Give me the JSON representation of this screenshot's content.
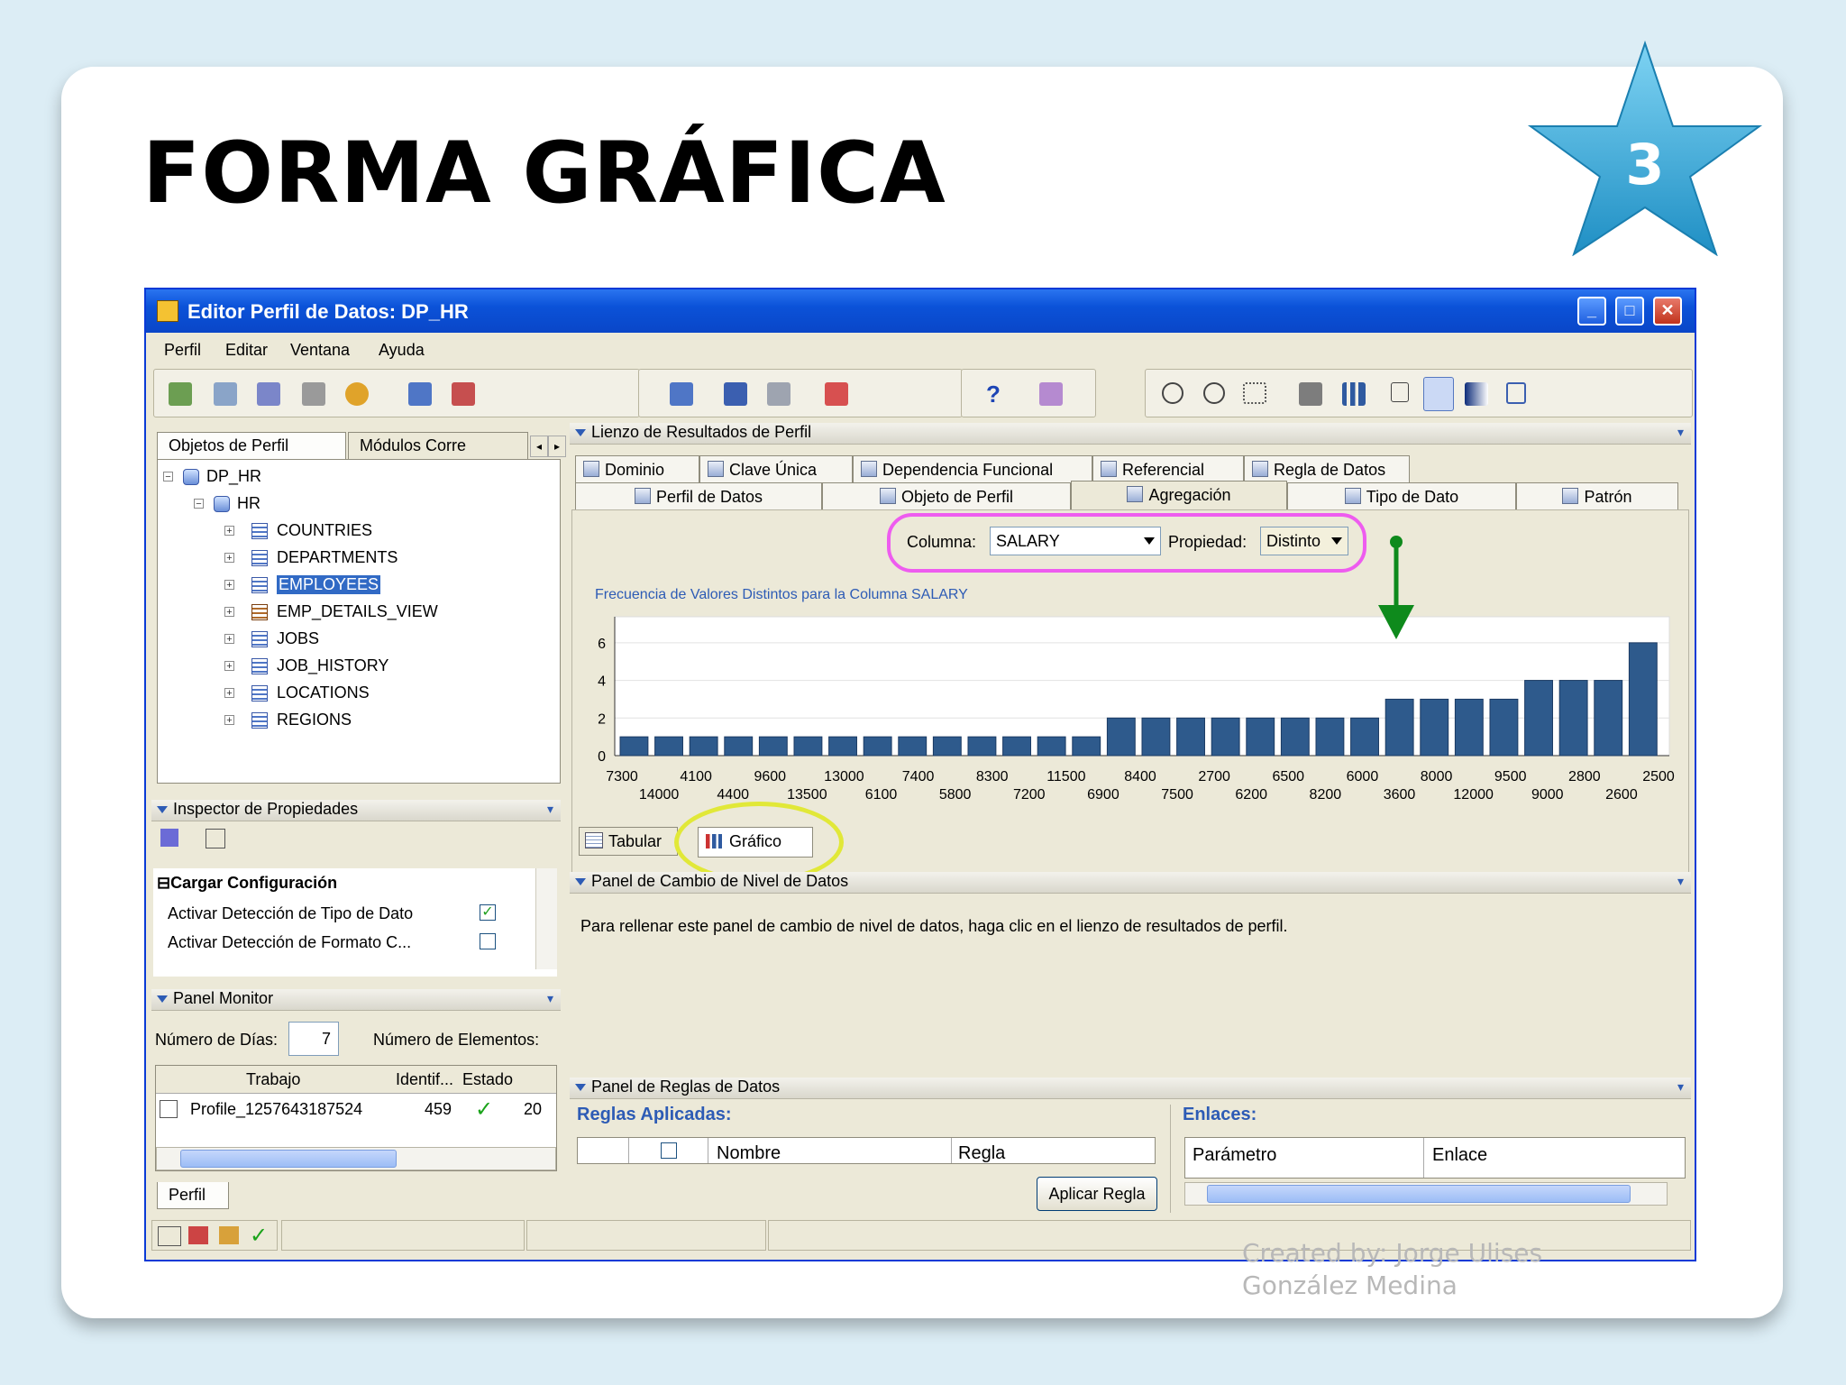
{
  "slide": {
    "title": "FORMA GRÁFICA",
    "badge_number": "3",
    "credit_line1": "Created by: Jorge Ulises",
    "credit_line2": "González Medina"
  },
  "window": {
    "title": "Editor Perfil de Datos: DP_HR",
    "menu": [
      "Perfil",
      "Editar",
      "Ventana",
      "Ayuda"
    ]
  },
  "toolbar_icons": [
    "database-icon",
    "copy-icon",
    "tag-icon",
    "print-icon",
    "ear-icon",
    "table-add-icon",
    "table-remove-icon",
    "grid-icon",
    "arrow-key-icon",
    "comment-icon",
    "target-icon",
    "help-icon",
    "flashlight-icon",
    "zoom-in-icon",
    "zoom-out-icon",
    "fit-icon",
    "select-icon",
    "bar-chart-icon",
    "list-icon",
    "grid-view-icon",
    "fill-icon",
    "cube-icon"
  ],
  "left": {
    "tabs": [
      "Objetos de Perfil",
      "Módulos Corre"
    ],
    "tree": {
      "root": "DP_HR",
      "schema": "HR",
      "tables": [
        {
          "name": "COUNTRIES",
          "type": "table"
        },
        {
          "name": "DEPARTMENTS",
          "type": "table"
        },
        {
          "name": "EMPLOYEES",
          "type": "table",
          "selected": true
        },
        {
          "name": "EMP_DETAILS_VIEW",
          "type": "view"
        },
        {
          "name": "JOBS",
          "type": "table"
        },
        {
          "name": "JOB_HISTORY",
          "type": "table"
        },
        {
          "name": "LOCATIONS",
          "type": "table"
        },
        {
          "name": "REGIONS",
          "type": "table"
        }
      ]
    },
    "inspector": {
      "title": "Inspector de Propiedades",
      "section": "Cargar Configuración",
      "rows": [
        {
          "label": "Activar Detección de Tipo de Dato",
          "checked": true
        },
        {
          "label": "Activar Detección de Formato C...",
          "checked": false
        }
      ]
    },
    "monitor": {
      "title": "Panel Monitor",
      "days_label": "Número de Días:",
      "days_value": "7",
      "elements_label": "Número de Elementos:",
      "columns": [
        "Trabajo",
        "Identif...",
        "Estado"
      ],
      "rows": [
        {
          "job": "Profile_1257643187524",
          "id": "459",
          "status_icon": "check-icon",
          "extra": "20"
        }
      ],
      "bottom_tab": "Perfil"
    }
  },
  "results": {
    "title": "Lienzo de Resultados de Perfil",
    "tabs_row1": [
      "Dominio",
      "Clave Única",
      "Dependencia Funcional",
      "Referencial",
      "Regla de Datos"
    ],
    "tabs_row2": [
      "Perfil de Datos",
      "Objeto de Perfil",
      "Agregación",
      "Tipo de Dato",
      "Patrón"
    ],
    "active_tab": "Agregación",
    "column_label": "Columna:",
    "column_value": "SALARY",
    "property_label": "Propiedad:",
    "property_value": "Distinto",
    "view_tabs": [
      "Tabular",
      "Gráfico"
    ]
  },
  "chart_data": {
    "type": "bar",
    "title": "Frecuencia de Valores Distintos para la Columna SALARY",
    "xlabel": "",
    "ylabel": "",
    "ylim": [
      0,
      7
    ],
    "yticks": [
      0,
      2,
      4,
      6
    ],
    "grid": true,
    "color": "#2e5a8c",
    "categories": [
      "7300",
      "14000",
      "4100",
      "4400",
      "9600",
      "13500",
      "13000",
      "6100",
      "7400",
      "5800",
      "8300",
      "7200",
      "11500",
      "6900",
      "8400",
      "7500",
      "2700",
      "6200",
      "6500",
      "8200",
      "6000",
      "3600",
      "8000",
      "12000",
      "9500",
      "9000",
      "2800",
      "2600",
      "2500"
    ],
    "values": [
      1,
      1,
      1,
      1,
      1,
      1,
      1,
      1,
      1,
      1,
      1,
      1,
      1,
      1,
      2,
      2,
      2,
      2,
      2,
      2,
      2,
      2,
      3,
      3,
      3,
      3,
      4,
      4,
      4,
      6
    ],
    "tick_labels_top": [
      "7300",
      "4100",
      "9600",
      "13000",
      "7400",
      "8300",
      "11500",
      "8400",
      "2700",
      "6500",
      "6000",
      "8000",
      "9500",
      "2800",
      "2500"
    ],
    "tick_labels_bottom": [
      "14000",
      "4400",
      "13500",
      "6100",
      "5800",
      "7200",
      "6900",
      "7500",
      "6200",
      "8200",
      "3600",
      "12000",
      "9000",
      "2600"
    ]
  },
  "drill": {
    "title": "Panel de Cambio de Nivel de Datos",
    "message": "Para rellenar este panel de cambio de nivel de datos, haga clic en el lienzo de resultados de perfil."
  },
  "rules": {
    "title": "Panel de Reglas de Datos",
    "applied_label": "Reglas Aplicadas:",
    "applied_columns": [
      "Nombre",
      "Regla"
    ],
    "apply_button": "Aplicar Regla",
    "links_label": "Enlaces:",
    "links_columns": [
      "Parámetro",
      "Enlace"
    ]
  }
}
